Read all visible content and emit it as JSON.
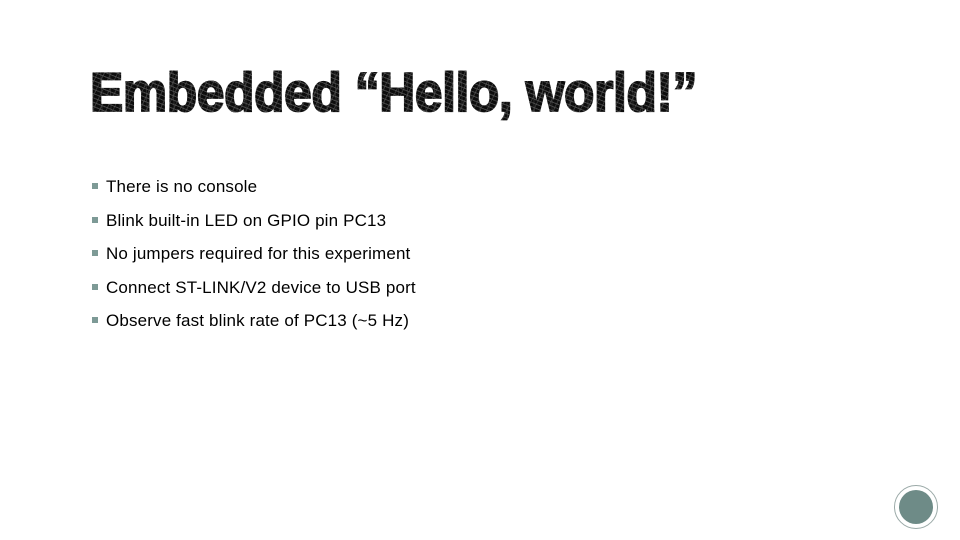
{
  "slide": {
    "title": "Embedded “Hello, world!”",
    "background_color": "#ffffff",
    "title_color": "#0d0d0d"
  },
  "body": {
    "bullet_marker_color": "#7d9a96",
    "text_color": "#000000",
    "items": [
      {
        "text": "There is no console"
      },
      {
        "text": "Blink built-in LED on GPIO pin PC13"
      },
      {
        "text": "No jumpers required for this experiment"
      },
      {
        "text": "Connect ST-LINK/V2 device to USB port"
      },
      {
        "text": "Observe fast blink rate of PC13 (~5 Hz)"
      }
    ]
  },
  "decoration": {
    "circle_fill_color": "#6e8b87",
    "circle_ring_color": "#9aa9a7"
  }
}
